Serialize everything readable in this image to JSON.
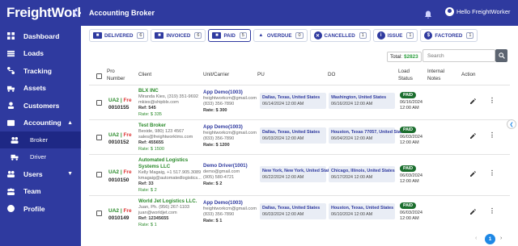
{
  "app": {
    "logo": "FreightWork",
    "page_title": "Accounting Broker",
    "user_name": "Hello FreightWorker"
  },
  "sidebar": {
    "items": [
      {
        "label": "Dashboard",
        "icon": "grid-icon"
      },
      {
        "label": "Loads",
        "icon": "loads-icon"
      },
      {
        "label": "Tracking",
        "icon": "route-icon"
      },
      {
        "label": "Assets",
        "icon": "truck-icon"
      },
      {
        "label": "Customers",
        "icon": "customers-icon"
      },
      {
        "label": "Accounting",
        "icon": "accounting-icon"
      },
      {
        "label": "Broker",
        "icon": "broker-icon"
      },
      {
        "label": "Driver",
        "icon": "driver-icon"
      },
      {
        "label": "Users",
        "icon": "users-icon"
      },
      {
        "label": "Team",
        "icon": "team-icon"
      },
      {
        "label": "Profile",
        "icon": "profile-icon"
      }
    ]
  },
  "tabs": [
    {
      "label": "DELIVERED",
      "count": "6"
    },
    {
      "label": "INVOICED",
      "count": "6"
    },
    {
      "label": "PAID",
      "count": "5"
    },
    {
      "label": "OVERDUE",
      "count": "0"
    },
    {
      "label": "CANCELLED",
      "count": "1"
    },
    {
      "label": "ISSUE",
      "count": "1"
    },
    {
      "label": "FACTORED",
      "count": "1"
    }
  ],
  "total": {
    "label": "Total:",
    "amount": "$2823"
  },
  "search": {
    "placeholder": "Search"
  },
  "columns": {
    "pro": "Pro Number",
    "client": "Client",
    "unit": "Unit/Carrier",
    "pu": "PU",
    "do": "DO",
    "load_status": "Load Status",
    "notes": "Internal Notes",
    "action": "Action"
  },
  "rows": [
    {
      "pro_code": "UA2",
      "pro_fre": "Fre",
      "pro_number": "0010155",
      "client_name": "BLX INC",
      "client_line1": "Miranda Kies, (319) 351-9692",
      "client_line2": "mkies@shipblx.com",
      "client_ref": "Ref: 545",
      "client_rate": "Rate: $ 335",
      "unit_name": "App Demo(1003)",
      "unit_email": "freightworkcm@gmail.com",
      "unit_phone": "(833) 356-7890",
      "unit_rate": "Rate: $ 300",
      "pu_city": "Dallas, Texas, United States",
      "pu_date": "06/14/2024 12:00 AM",
      "do_city": "Washington, United States",
      "do_date": "06/16/2024 12:00 AM",
      "status": "PAID",
      "status_date": "06/16/2024",
      "status_time": "12:00 AM"
    },
    {
      "pro_code": "UA2",
      "pro_fre": "Fre",
      "pro_number": "0010152",
      "client_name": "Test Broker",
      "client_line1": "Bexide, 980) 123 4567",
      "client_line2": "sales@freightworktms.com",
      "client_ref": "Ref: 455655",
      "client_rate": "Rate: $ 1500",
      "unit_name": "App Demo(1003)",
      "unit_email": "freightworkcm@gmail.com",
      "unit_phone": "(833) 356-7890",
      "unit_rate": "Rate: $ 1200",
      "pu_city": "Dallas, Texas, United States",
      "pu_date": "06/03/2024 12:00 AM",
      "do_city": "Houston, Texas 77057, United States",
      "do_date": "06/04/2024 12:00 AM",
      "status": "PAID",
      "status_date": "06/03/2024",
      "status_time": "12:00 AM"
    },
    {
      "pro_code": "UA2",
      "pro_fre": "Fre",
      "pro_number": "0010150",
      "client_name": "Automated Logistics Systems LLC",
      "client_line1": "Kelly Magaig, +1 517.905.3089",
      "client_line2": "kmagaig@automatedlogistics...",
      "client_ref": "Ref: 33",
      "client_rate": "Rate: $ 2",
      "unit_name": "Demo Driver(1001)",
      "unit_email": "demo@gmail.com",
      "unit_phone": "(905) 580-4721",
      "unit_rate": "Rate: $ 2",
      "pu_city": "New York, New York, United States",
      "pu_date": "06/22/2024 12:00 AM",
      "do_city": "Chicago, Illinois, United States",
      "do_date": "06/17/2024 12:00 AM",
      "status": "PAID",
      "status_date": "06/03/2024",
      "status_time": "12:00 AM"
    },
    {
      "pro_code": "UA2",
      "pro_fre": "Fre",
      "pro_number": "0010149",
      "client_name": "World Jet Logistics LLC.",
      "client_line1": "Juan, Ph. (956) 267-1103",
      "client_line2": "juan@worldjet.com",
      "client_ref": "Ref: 12345655",
      "client_rate": "Rate: $ 1",
      "unit_name": "App Demo(1003)",
      "unit_email": "freightworkcm@gmail.com",
      "unit_phone": "(833) 356-7890",
      "unit_rate": "Rate: $ 1",
      "pu_city": "Dallas, Texas, United States",
      "pu_date": "06/03/2024 12:00 AM",
      "do_city": "Houston, Texas, United States",
      "do_date": "06/10/2024 12:00 AM",
      "status": "PAID",
      "status_date": "06/03/2024",
      "status_time": "12:00 AM"
    }
  ],
  "pagination": {
    "current": "1"
  }
}
